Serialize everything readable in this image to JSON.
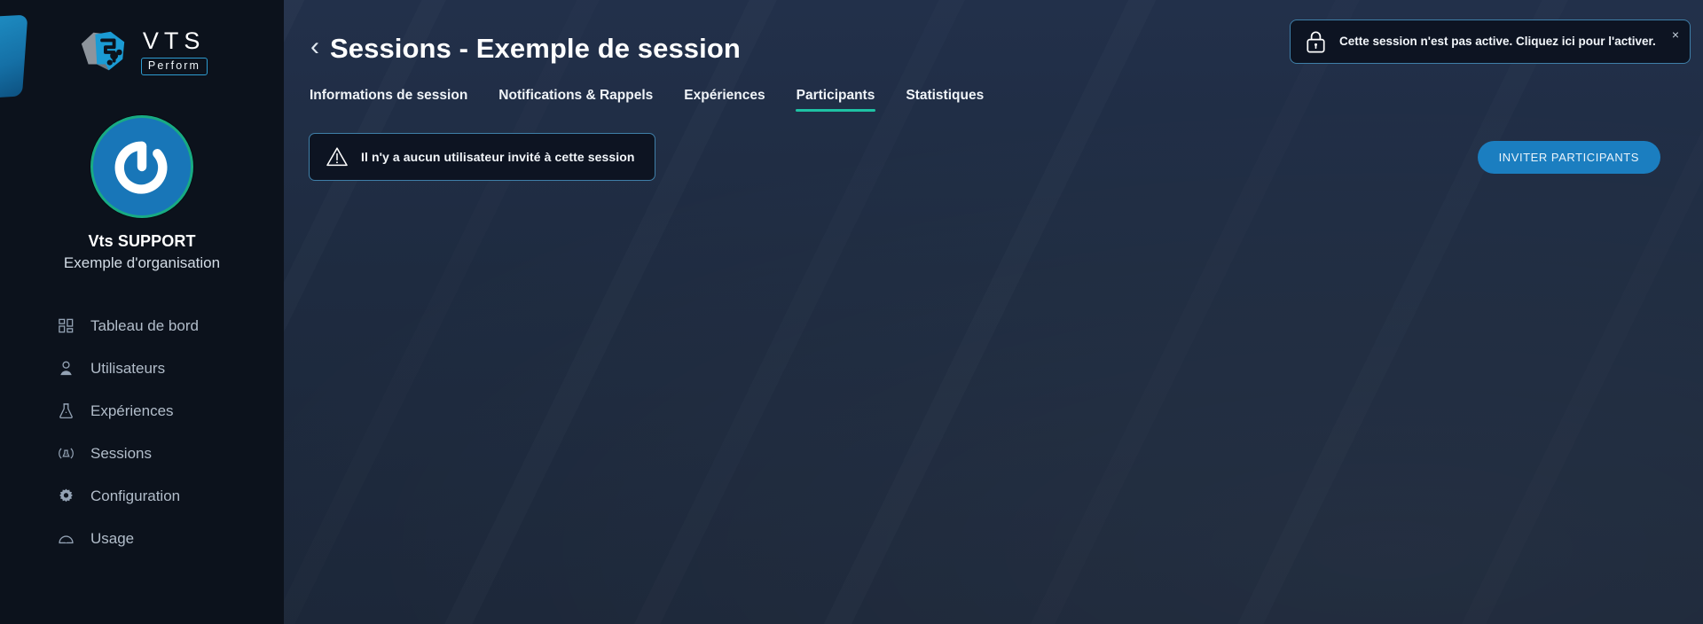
{
  "brand": {
    "name": "VTS",
    "product": "Perform",
    "logo_icon": "vts-hexagon-logo-icon"
  },
  "sidebar": {
    "profile": {
      "avatar_icon": "power-button-avatar-icon",
      "name": "Vts SUPPORT",
      "organisation": "Exemple d'organisation"
    },
    "items": [
      {
        "label": "Tableau de bord",
        "icon": "dashboard-grid-icon",
        "key": "tableau-de-bord"
      },
      {
        "label": "Utilisateurs",
        "icon": "user-icon",
        "key": "utilisateurs"
      },
      {
        "label": "Expériences",
        "icon": "flask-icon",
        "key": "experiences"
      },
      {
        "label": "Sessions",
        "icon": "session-broadcast-icon",
        "key": "sessions"
      },
      {
        "label": "Configuration",
        "icon": "gear-icon",
        "key": "configuration"
      },
      {
        "label": "Usage",
        "icon": "gauge-icon",
        "key": "usage"
      }
    ]
  },
  "header": {
    "back_icon": "chevron-left-icon",
    "title": "Sessions - Exemple de session"
  },
  "tabs": [
    {
      "label": "Informations de session",
      "active": false
    },
    {
      "label": "Notifications & Rappels",
      "active": false
    },
    {
      "label": "Expériences",
      "active": false
    },
    {
      "label": "Participants",
      "active": true
    },
    {
      "label": "Statistiques",
      "active": false
    }
  ],
  "content": {
    "alert": {
      "icon": "warning-triangle-icon",
      "text": "Il n'y a aucun utilisateur invité à cette session"
    },
    "invite_button_label": "INVITER PARTICIPANTS"
  },
  "toast": {
    "icon": "lock-icon",
    "text": "Cette session n'est pas active. Cliquez ici pour l'activer.",
    "close_label": "×"
  },
  "colors": {
    "accent_teal": "#1ec2a4",
    "accent_blue": "#1b7ec0",
    "sidebar_bg": "#0c121c",
    "content_bg": "#1e2b40",
    "border_blue": "#3f7fa8",
    "avatar_ring": "#18ab83"
  }
}
